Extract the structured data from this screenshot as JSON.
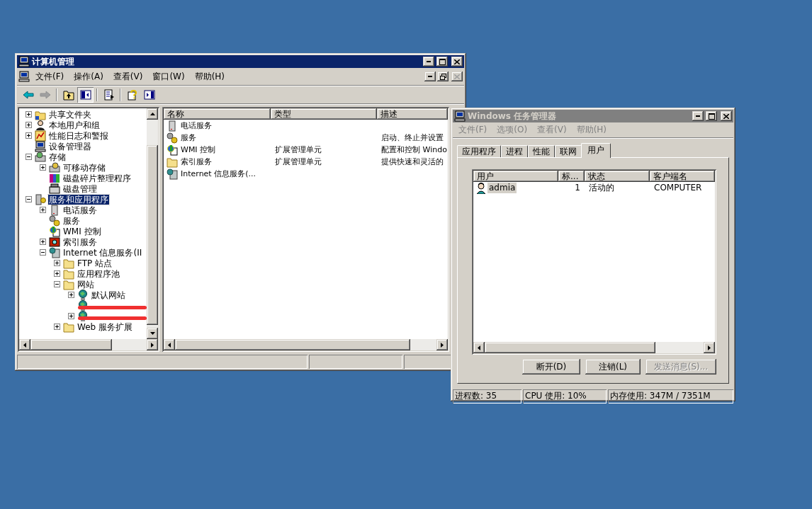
{
  "computer_management": {
    "title": "计算机管理",
    "menu": [
      "文件(F)",
      "操作(A)",
      "查看(V)",
      "窗口(W)",
      "帮助(H)"
    ],
    "toolbar": [
      {
        "kind": "back",
        "disabled": false,
        "pressed": false
      },
      {
        "kind": "forward",
        "disabled": true,
        "pressed": false
      },
      {
        "kind": "separator"
      },
      {
        "kind": "up",
        "pressed": false
      },
      {
        "kind": "tree",
        "pressed": true
      },
      {
        "kind": "separator"
      },
      {
        "kind": "export",
        "pressed": false
      },
      {
        "kind": "separator"
      },
      {
        "kind": "help",
        "pressed": false
      },
      {
        "kind": "action",
        "pressed": false
      }
    ],
    "tree": [
      {
        "children": [
          {
            "label": "共享文件夹",
            "kind": "share",
            "expanded": false,
            "selected": false
          },
          {
            "label": "本地用户和组",
            "kind": "users",
            "expanded": false,
            "selected": false
          },
          {
            "label": "性能日志和警报",
            "kind": "perf",
            "expanded": false,
            "selected": false
          },
          {
            "label": "设备管理器",
            "kind": "device",
            "selected": false
          }
        ]
      },
      {
        "label": "存储",
        "kind": "storage",
        "expanded": true,
        "selected": false,
        "children": [
          {
            "label": "可移动存储",
            "kind": "removable",
            "expanded": false,
            "selected": false
          },
          {
            "label": "磁盘碎片整理程序",
            "kind": "defrag",
            "selected": false
          },
          {
            "label": "磁盘管理",
            "kind": "disk",
            "selected": false
          }
        ]
      },
      {
        "label": "服务和应用程序",
        "kind": "services",
        "expanded": true,
        "selected": true,
        "children": [
          {
            "label": "电话服务",
            "kind": "server",
            "expanded": false,
            "selected": false
          },
          {
            "label": "服务",
            "kind": "gear",
            "selected": false
          },
          {
            "label": "WMI 控制",
            "kind": "wmi",
            "selected": false
          },
          {
            "label": "索引服务",
            "kind": "index",
            "expanded": false,
            "selected": false
          },
          {
            "label": "Internet 信息服务(II",
            "kind": "iis",
            "expanded": true,
            "selected": false,
            "children": [
              {
                "label": "FTP 站点",
                "kind": "folder",
                "expanded": false,
                "selected": false
              },
              {
                "label": "应用程序池",
                "kind": "folder",
                "expanded": false,
                "selected": false
              },
              {
                "label": "网站",
                "kind": "folder",
                "expanded": true,
                "selected": false,
                "children": [
                  {
                    "label": "默认网站",
                    "kind": "globe",
                    "expanded": false,
                    "selected": false
                  },
                  {
                    "kind": "globe",
                    "redacted": true
                  },
                  {
                    "kind": "globe",
                    "expanded": false,
                    "redacted": true
                  }
                ]
              },
              {
                "label": "Web 服务扩展",
                "kind": "folder",
                "expanded": false,
                "selected": false
              }
            ]
          }
        ]
      }
    ],
    "list": {
      "columns": [
        "名称",
        "类型",
        "描述"
      ],
      "rows": [
        {
          "kind": "server",
          "name": "电话服务"
        },
        {
          "kind": "gear",
          "name": "服务",
          "description": "启动、终止并设置"
        },
        {
          "kind": "wmi",
          "name": "WMI 控制",
          "type": "扩展管理单元",
          "description": "配置和控制 Windo"
        },
        {
          "kind": "folder",
          "name": "索引服务",
          "type": "扩展管理单元",
          "description": "提供快速和灵活的"
        },
        {
          "kind": "iis",
          "name": "Internet 信息服务(..."
        }
      ]
    }
  },
  "task_manager": {
    "title": "Windows 任务管理器",
    "menu": [
      "文件(F)",
      "选项(O)",
      "查看(V)",
      "帮助(H)"
    ],
    "tabs": [
      {
        "label": "应用程序",
        "selected": false
      },
      {
        "label": "进程",
        "selected": false
      },
      {
        "label": "性能",
        "selected": false
      },
      {
        "label": "联网",
        "selected": false
      },
      {
        "label": "用户",
        "selected": true
      }
    ],
    "users": {
      "columns": [
        "用户",
        "标...",
        "状态",
        "客户端名"
      ],
      "rows": [
        {
          "user": "admia",
          "id": "1",
          "status": "活动的",
          "client": "COMPUTER",
          "selected": true
        }
      ]
    },
    "buttons": [
      {
        "label": "断开(D)",
        "disabled": false
      },
      {
        "label": "注销(L)",
        "disabled": false
      },
      {
        "label": "发送消息(S)...",
        "disabled": true
      }
    ],
    "status_bar": [
      "进程数: 35",
      "CPU 使用: 10%",
      "内存使用: 347M / 7351M"
    ]
  }
}
